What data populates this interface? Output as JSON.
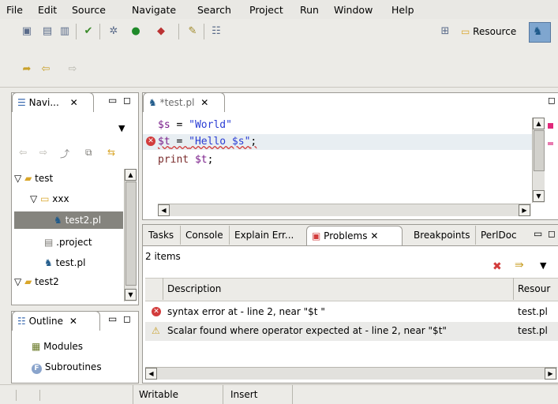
{
  "menu": [
    "File",
    "Edit",
    "Source",
    "Navigate",
    "Search",
    "Project",
    "Run",
    "Window",
    "Help"
  ],
  "toolbar": {
    "resource_label": "Resource"
  },
  "navigator": {
    "tab_label": "Navi...",
    "tree": [
      {
        "label": "test",
        "level": 0
      },
      {
        "label": "xxx",
        "level": 1
      },
      {
        "label": "test2.pl",
        "level": 2
      },
      {
        "label": ".project",
        "level": 1
      },
      {
        "label": "test.pl",
        "level": 1
      },
      {
        "label": "test2",
        "level": 0
      }
    ]
  },
  "outline": {
    "tab_label": "Outline",
    "items": [
      "Modules",
      "Subroutines"
    ]
  },
  "editor": {
    "tab_label": "*test.pl",
    "lines": [
      {
        "a": "$s",
        "b": " = ",
        "c": "\"World\""
      },
      {
        "a": "$t",
        "b": " = ",
        "c": "\"Hello $s\"",
        "d": ";"
      },
      {
        "a": "print",
        "b": " ",
        "c": "$t",
        "d": ";"
      }
    ]
  },
  "bottom": {
    "tabs": [
      "Tasks",
      "Console",
      "Explain Err...",
      "Problems",
      "Breakpoints",
      "PerlDoc"
    ],
    "count": "2 items",
    "columns": {
      "description": "Description",
      "resource": "Resour"
    },
    "rows": [
      {
        "severity": "error",
        "description": "syntax error at - line 2, near \"$t \"",
        "resource": "test.pl"
      },
      {
        "severity": "warning",
        "description": "Scalar found where operator expected at - line 2, near \"$t\"",
        "resource": "test.pl"
      }
    ]
  },
  "status": {
    "writable": "Writable",
    "insert": "Insert"
  }
}
